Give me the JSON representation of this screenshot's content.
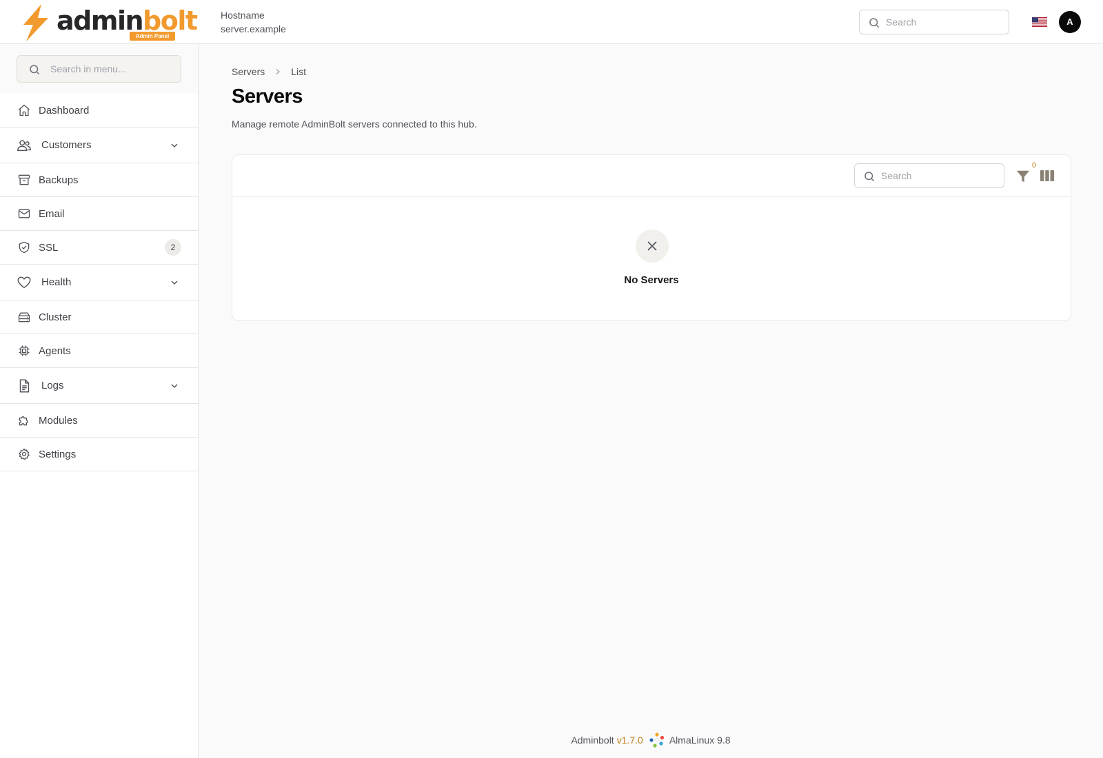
{
  "brand": {
    "name_part1": "admin",
    "name_part2": "bolt",
    "badge": "Admin Panel",
    "accent_color": "#f29a2e"
  },
  "header": {
    "host_label": "Hostname",
    "host_value": "server.example",
    "search_placeholder": "Search",
    "language_flag": "us-flag-icon",
    "avatar_initial": "A"
  },
  "sidebar": {
    "search_placeholder": "Search in menu...",
    "items": [
      {
        "label": "Dashboard",
        "icon": "home-icon"
      },
      {
        "label": "Customers",
        "icon": "users-icon",
        "expandable": true
      },
      {
        "label": "Backups",
        "icon": "archive-icon"
      },
      {
        "label": "Email",
        "icon": "envelope-icon"
      },
      {
        "label": "SSL",
        "icon": "shield-check-icon",
        "count": "2"
      },
      {
        "label": "Health",
        "icon": "heart-icon",
        "expandable": true
      },
      {
        "label": "Cluster",
        "icon": "server-stack-icon"
      },
      {
        "label": "Agents",
        "icon": "cpu-chip-icon"
      },
      {
        "label": "Logs",
        "icon": "document-icon",
        "expandable": true
      },
      {
        "label": "Modules",
        "icon": "puzzle-icon"
      },
      {
        "label": "Settings",
        "icon": "cog-icon"
      }
    ]
  },
  "main": {
    "breadcrumb": [
      "Servers",
      "List"
    ],
    "title": "Servers",
    "description": "Manage remote AdminBolt servers connected to this hub.",
    "table": {
      "search_placeholder": "Search",
      "filter_count": "0",
      "empty_text": "No Servers"
    }
  },
  "footer": {
    "product": "Adminbolt",
    "version": "v1.7.0",
    "os": "AlmaLinux 9.8"
  }
}
